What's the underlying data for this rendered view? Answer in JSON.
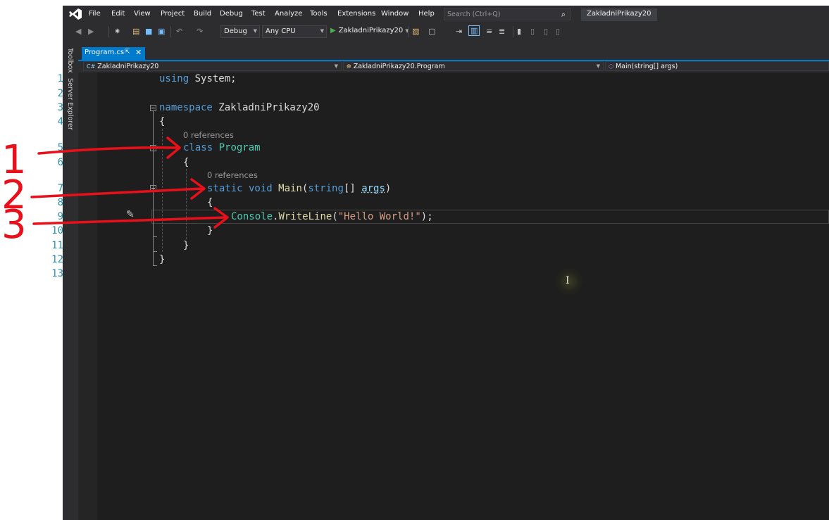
{
  "menu": {
    "items": [
      "File",
      "Edit",
      "View",
      "Project",
      "Build",
      "Debug",
      "Test",
      "Analyze",
      "Tools",
      "Extensions",
      "Window",
      "Help"
    ],
    "search_placeholder": "Search (Ctrl+Q)",
    "solution_title": "ZakladniPrikazy20"
  },
  "toolbar": {
    "configuration": "Debug",
    "platform": "Any CPU",
    "run_target": "ZakladniPrikazy20"
  },
  "side_tabs": [
    "Toolbox",
    "Server Explorer"
  ],
  "document_tab": {
    "label": "Program.cs"
  },
  "navigation_bar": {
    "project": "ZakladniPrikazy20",
    "type": "ZakladniPrikazy20.Program",
    "member": "Main(string[] args)"
  },
  "editor": {
    "line_numbers": [
      "1",
      "2",
      "3",
      "4",
      "5",
      "6",
      "7",
      "8",
      "9",
      "10",
      "11",
      "12",
      "13"
    ],
    "codelens_class": "0 references",
    "codelens_main": "0 references",
    "tokens": {
      "using": "using",
      "system": " System;",
      "namespace": "namespace",
      "ns_name": " ZakladniPrikazy20",
      "brace_open": "{",
      "brace_close": "}",
      "class": "class",
      "class_name": " Program",
      "static": "static",
      "void": " void",
      "main": " Main",
      "paren_open": "(",
      "string": "string",
      "arr": "[] ",
      "args": "args",
      "paren_close": ")",
      "console": "Console",
      "dot": ".",
      "writeline": "WriteLine",
      "hello": "\"Hello World!\"",
      "end": ");"
    }
  },
  "annotations": {
    "labels": [
      "1",
      "2",
      "3"
    ],
    "color": "#e8101a"
  },
  "colors": {
    "accent": "#007acc",
    "editor_bg": "#1e1e1e",
    "chrome_bg": "#2d2d30"
  }
}
